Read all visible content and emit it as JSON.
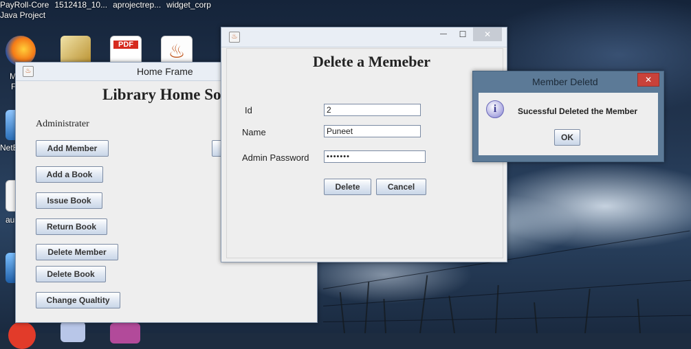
{
  "taskbar_titles": [
    "PayRoll-Core",
    "1512418_10...",
    "aprojectrep...",
    "widget_corp"
  ],
  "taskbar_sub": "Java Project",
  "desktop_labels": [
    "M",
    "F",
    "NetB",
    "au"
  ],
  "home_frame": {
    "title": "Home Frame",
    "heading": "Library Home So",
    "role_label": "Administrater",
    "buttons": [
      "Add Member",
      "Add a Book",
      "Issue Book",
      "Return Book",
      "Delete Member",
      "Delete Book",
      "Change Qualtity"
    ]
  },
  "delete_dialog": {
    "heading": "Delete a Memeber",
    "id_label": "Id",
    "id_value": "2",
    "name_label": "Name",
    "name_value": "Puneet",
    "password_label": "Admin Password",
    "password_value": "•••••••",
    "delete_button": "Delete",
    "cancel_button": "Cancel",
    "minimize_glyph": "—",
    "maximize_glyph": "☐",
    "close_glyph": "✕"
  },
  "message_box": {
    "title": "Member Deletd",
    "message": "Sucessful Deleted the Member",
    "ok_button": "OK",
    "info_glyph": "i",
    "close_glyph": "✕"
  },
  "icons": {
    "pdf_text": "PDF",
    "java_glyph": "♨"
  }
}
